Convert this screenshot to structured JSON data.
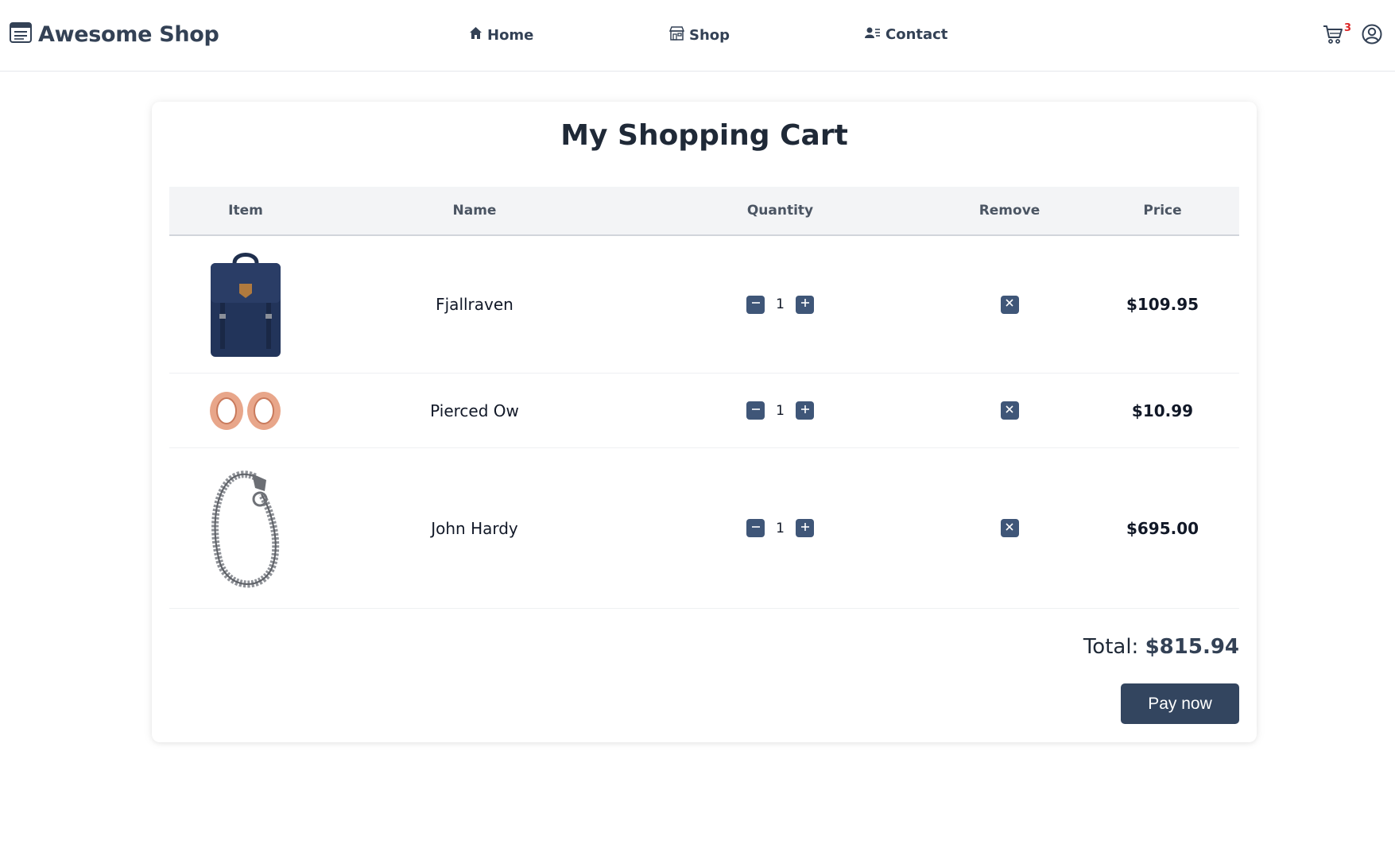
{
  "brand": {
    "name": "Awesome Shop",
    "icon": "menu-box-icon"
  },
  "nav": [
    {
      "label": "Home",
      "icon": "home-icon"
    },
    {
      "label": "Shop",
      "icon": "store-icon"
    },
    {
      "label": "Contact",
      "icon": "contact-card-icon"
    }
  ],
  "cart": {
    "count": "3",
    "icon": "cart-icon",
    "badge_color": "#dc2626"
  },
  "account": {
    "icon": "user-circle-icon"
  },
  "page": {
    "title": "My Shopping Cart"
  },
  "table": {
    "headers": {
      "item": "Item",
      "name": "Name",
      "quantity": "Quantity",
      "remove": "Remove",
      "price": "Price"
    },
    "rows": [
      {
        "image": "navy-backpack",
        "name": "Fjallraven",
        "quantity": "1",
        "price": "$109.95"
      },
      {
        "image": "rose-gold-plugs",
        "name": "Pierced Ow",
        "quantity": "1",
        "price": "$10.99"
      },
      {
        "image": "silver-dragon-bracelet",
        "name": "John Hardy",
        "quantity": "1",
        "price": "$695.00"
      }
    ]
  },
  "summary": {
    "total_label": "Total:",
    "total_value": "$815.94",
    "pay_label": "Pay now"
  },
  "colors": {
    "accent": "#3f5678",
    "button_dark": "#33455f",
    "header_text": "#334155"
  }
}
